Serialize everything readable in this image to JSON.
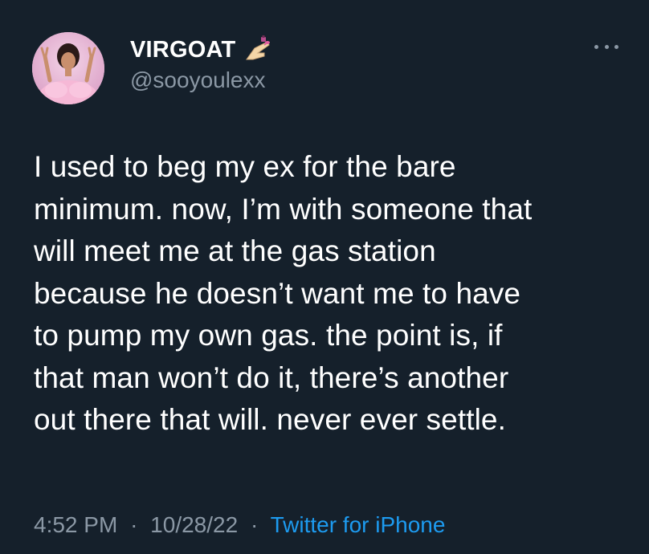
{
  "author": {
    "display_name": "VIRGOAT",
    "handle": "@sooyoulexx",
    "name_emoji": "nail-polish-icon"
  },
  "tweet": {
    "lines": [
      "I used to beg my ex for the bare",
      "minimum. now, I’m with someone that",
      "will meet me at the gas station",
      "because he doesn’t want me to have",
      "to pump my own gas. the point is, if",
      "that man won’t do it, there’s another",
      "out there that will. never ever settle."
    ]
  },
  "meta": {
    "time": "4:52 PM",
    "date": "10/28/22",
    "separator": "·",
    "source": "Twitter for iPhone"
  },
  "colors": {
    "background": "#15202b",
    "text": "#ffffff",
    "secondary": "#8b98a5",
    "link": "#1d9bf0"
  }
}
